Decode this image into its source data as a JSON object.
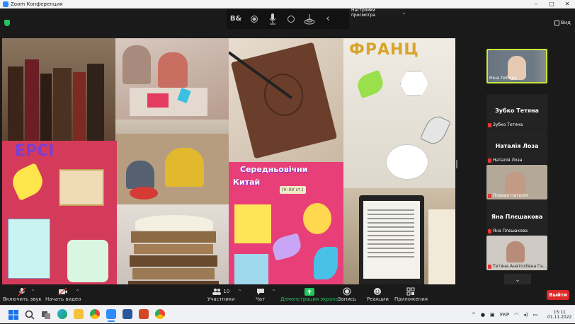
{
  "window": {
    "title": "Zoom Конференция",
    "minimize": "–",
    "maximize": "□",
    "close": "✕"
  },
  "meeting": {
    "view_label": "Вид"
  },
  "share_toolbar": {
    "options_label": "Настройки просмотра",
    "options_caret": "⌄"
  },
  "shared_screen": {
    "tile_texts": {
      "mythology_banner": "ЕРСІ",
      "medieval_banner_line1": "Середньовічни",
      "medieval_banner_line2": "Китай",
      "medieval_dates": "(V–XV ст.)",
      "top_banner": "ФРАНЦ"
    }
  },
  "participants": [
    {
      "name_label": "Ніна Лобода",
      "type": "video",
      "active_speaker": true
    },
    {
      "display_name": "Зубко Тетяна",
      "name_label": "Зубко Тетяна",
      "type": "name",
      "muted": true
    },
    {
      "display_name": "Наталія Лоза",
      "name_label": "Наталія Лоза",
      "type": "name",
      "muted": true
    },
    {
      "name_label": "Плавая Наталія",
      "type": "video",
      "muted": true
    },
    {
      "display_name": "Яна Плєшакова",
      "name_label": "Яна Плєшакова",
      "type": "name",
      "muted": true
    },
    {
      "name_label": "Тетяна Анатоліївна Га...",
      "type": "video",
      "muted": true
    }
  ],
  "participant_panel": {
    "scroll_down_icon": "chevron-down-icon"
  },
  "bottom_bar": {
    "audio_label": "Включить звук",
    "video_label": "Начать видео",
    "participants_label": "Участники",
    "participants_count": "10",
    "chat_label": "Чат",
    "share_label": "Демонстрация экрана",
    "record_label": "Запись",
    "reactions_label": "Реакции",
    "apps_label": "Приложения",
    "leave_label": "Выйти",
    "share_color": "#22c55e",
    "leave_color": "#e02828"
  },
  "taskbar": {
    "keyboard_layout": "УКР",
    "time": "15:11",
    "date": "01.11.2022",
    "apps": [
      "windows-start-icon",
      "search-icon",
      "task-view-icon",
      "edge-icon",
      "file-explorer-icon",
      "chrome-icon",
      "zoom-icon",
      "word-icon",
      "powerpoint-icon",
      "chrome-profile-icon"
    ]
  }
}
